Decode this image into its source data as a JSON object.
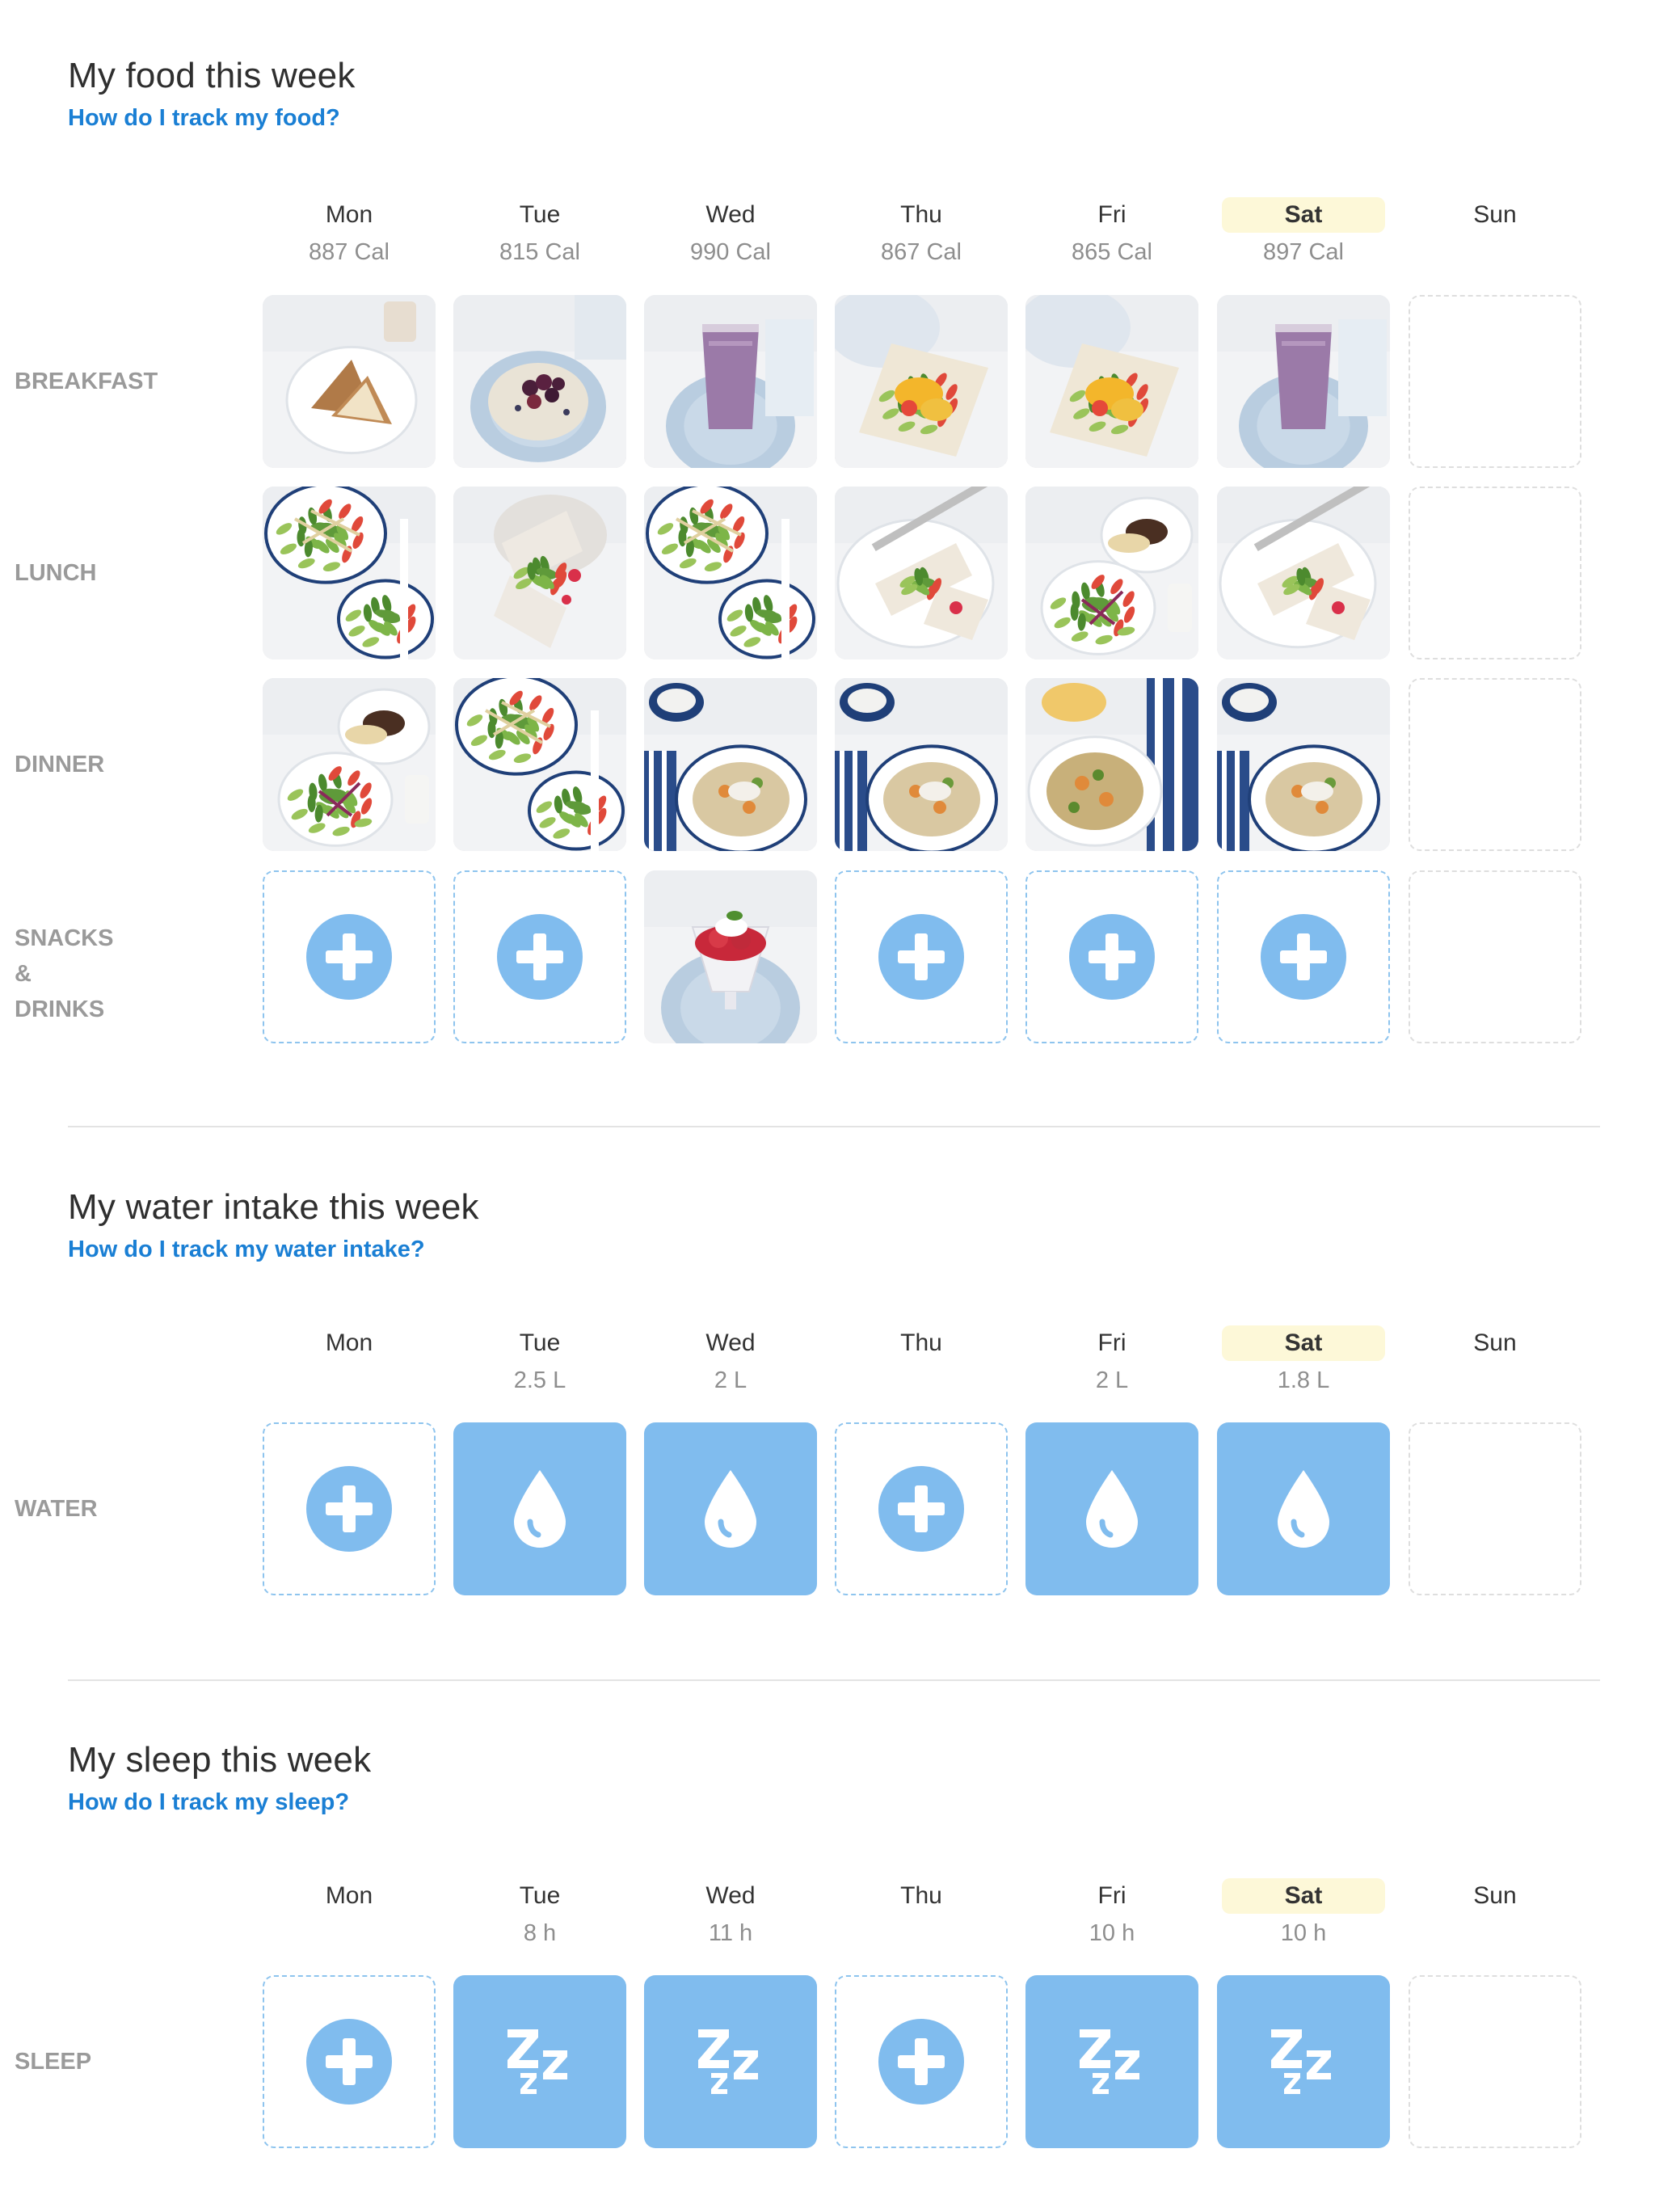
{
  "colors": {
    "accent_blue": "#80bcee",
    "link_blue": "#1a7fd4",
    "today_highlight": "#fdf8d8",
    "label_gray": "#9a9a9a"
  },
  "days": [
    "Mon",
    "Tue",
    "Wed",
    "Thu",
    "Fri",
    "Sat",
    "Sun"
  ],
  "today": "Sat",
  "food": {
    "title": "My food this week",
    "help_link": "How do I track my food?",
    "calories": [
      "887 Cal",
      "815 Cal",
      "990 Cal",
      "867 Cal",
      "865 Cal",
      "897 Cal",
      ""
    ],
    "rows": [
      {
        "label": "BREAKFAST",
        "cells": [
          "toasted-sandwich",
          "berry-muesli-bowl",
          "berry-smoothie",
          "egg-salad-wrap",
          "egg-salad-wrap",
          "berry-smoothie",
          "empty"
        ]
      },
      {
        "label": "LUNCH",
        "cells": [
          "noodle-salad",
          "salad-wrap",
          "noodle-salad",
          "chicken-wrap",
          "steak-salad",
          "chicken-wrap",
          "empty"
        ]
      },
      {
        "label": "DINNER",
        "cells": [
          "steak-salad",
          "noodle-salad",
          "grain-bowl",
          "grain-bowl",
          "grain-salad",
          "grain-bowl",
          "empty"
        ]
      },
      {
        "label_line1": "SNACKS &",
        "label_line2": "DRINKS",
        "cells": [
          "add",
          "add",
          "strawberry-dessert",
          "add",
          "add",
          "add",
          "empty"
        ]
      }
    ]
  },
  "water": {
    "title": "My water intake this week",
    "help_link": "How do I track my water intake?",
    "values": [
      "",
      "2.5 L",
      "2 L",
      "",
      "2 L",
      "1.8 L",
      ""
    ],
    "row_label": "WATER",
    "cells": [
      "add",
      "water-drop-icon",
      "water-drop-icon",
      "add",
      "water-drop-icon",
      "water-drop-icon",
      "empty"
    ]
  },
  "sleep": {
    "title": "My sleep this week",
    "help_link": "How do I track my sleep?",
    "values": [
      "",
      "8 h",
      "11 h",
      "",
      "10 h",
      "10 h",
      ""
    ],
    "row_label": "SLEEP",
    "cells": [
      "add",
      "sleep-zzz-icon",
      "sleep-zzz-icon",
      "add",
      "sleep-zzz-icon",
      "sleep-zzz-icon",
      "empty"
    ]
  }
}
